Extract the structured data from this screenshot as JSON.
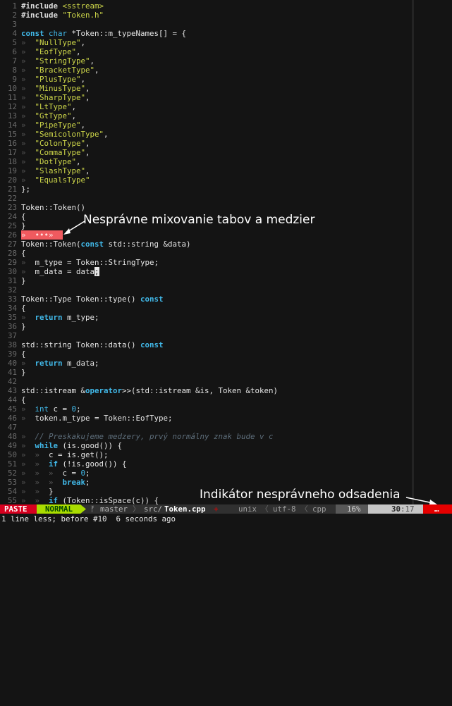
{
  "editor": {
    "lines": [
      {
        "n": "1",
        "segs": [
          {
            "t": "#include ",
            "c": "inc"
          },
          {
            "t": "<sstream>",
            "c": "str"
          }
        ]
      },
      {
        "n": "2",
        "segs": [
          {
            "t": "#include ",
            "c": "inc"
          },
          {
            "t": "\"Token.h\"",
            "c": "str"
          }
        ]
      },
      {
        "n": "3",
        "segs": []
      },
      {
        "n": "4",
        "segs": [
          {
            "t": "const",
            "c": "kw"
          },
          {
            "t": " "
          },
          {
            "t": "char",
            "c": "ty"
          },
          {
            "t": " *Token::m_typeNames[] = {"
          }
        ]
      },
      {
        "n": "5",
        "segs": [
          {
            "t": "»  ",
            "c": "tab"
          },
          {
            "t": "\"NullType\"",
            "c": "str"
          },
          {
            "t": ","
          }
        ]
      },
      {
        "n": "6",
        "segs": [
          {
            "t": "»  ",
            "c": "tab"
          },
          {
            "t": "\"EofType\"",
            "c": "str"
          },
          {
            "t": ","
          }
        ]
      },
      {
        "n": "7",
        "segs": [
          {
            "t": "»  ",
            "c": "tab"
          },
          {
            "t": "\"StringType\"",
            "c": "str"
          },
          {
            "t": ","
          }
        ]
      },
      {
        "n": "8",
        "segs": [
          {
            "t": "»  ",
            "c": "tab"
          },
          {
            "t": "\"BracketType\"",
            "c": "str"
          },
          {
            "t": ","
          }
        ]
      },
      {
        "n": "9",
        "segs": [
          {
            "t": "»  ",
            "c": "tab"
          },
          {
            "t": "\"PlusType\"",
            "c": "str"
          },
          {
            "t": ","
          }
        ]
      },
      {
        "n": "10",
        "segs": [
          {
            "t": "»  ",
            "c": "tab"
          },
          {
            "t": "\"MinusType\"",
            "c": "str"
          },
          {
            "t": ","
          }
        ]
      },
      {
        "n": "11",
        "segs": [
          {
            "t": "»  ",
            "c": "tab"
          },
          {
            "t": "\"SharpType\"",
            "c": "str"
          },
          {
            "t": ","
          }
        ]
      },
      {
        "n": "12",
        "segs": [
          {
            "t": "»  ",
            "c": "tab"
          },
          {
            "t": "\"LtType\"",
            "c": "str"
          },
          {
            "t": ","
          }
        ]
      },
      {
        "n": "13",
        "segs": [
          {
            "t": "»  ",
            "c": "tab"
          },
          {
            "t": "\"GtType\"",
            "c": "str"
          },
          {
            "t": ","
          }
        ]
      },
      {
        "n": "14",
        "segs": [
          {
            "t": "»  ",
            "c": "tab"
          },
          {
            "t": "\"PipeType\"",
            "c": "str"
          },
          {
            "t": ","
          }
        ]
      },
      {
        "n": "15",
        "segs": [
          {
            "t": "»  ",
            "c": "tab"
          },
          {
            "t": "\"SemicolonType\"",
            "c": "str"
          },
          {
            "t": ","
          }
        ]
      },
      {
        "n": "16",
        "segs": [
          {
            "t": "»  ",
            "c": "tab"
          },
          {
            "t": "\"ColonType\"",
            "c": "str"
          },
          {
            "t": ","
          }
        ]
      },
      {
        "n": "17",
        "segs": [
          {
            "t": "»  ",
            "c": "tab"
          },
          {
            "t": "\"CommaType\"",
            "c": "str"
          },
          {
            "t": ","
          }
        ]
      },
      {
        "n": "18",
        "segs": [
          {
            "t": "»  ",
            "c": "tab"
          },
          {
            "t": "\"DotType\"",
            "c": "str"
          },
          {
            "t": ","
          }
        ]
      },
      {
        "n": "19",
        "segs": [
          {
            "t": "»  ",
            "c": "tab"
          },
          {
            "t": "\"SlashType\"",
            "c": "str"
          },
          {
            "t": ","
          }
        ]
      },
      {
        "n": "20",
        "segs": [
          {
            "t": "»  ",
            "c": "tab"
          },
          {
            "t": "\"EqualsType\"",
            "c": "str"
          }
        ]
      },
      {
        "n": "21",
        "segs": [
          {
            "t": "};"
          }
        ]
      },
      {
        "n": "22",
        "segs": []
      },
      {
        "n": "23",
        "segs": [
          {
            "t": "Token::Token()"
          }
        ]
      },
      {
        "n": "24",
        "segs": [
          {
            "t": "{"
          }
        ]
      },
      {
        "n": "25",
        "segs": [
          {
            "t": "}"
          }
        ]
      },
      {
        "n": "26",
        "segs": [
          {
            "t": "»  •••»  ",
            "c": "bad"
          }
        ]
      },
      {
        "n": "27",
        "segs": [
          {
            "t": "Token::Token("
          },
          {
            "t": "const",
            "c": "kw"
          },
          {
            "t": " std::string &data)"
          }
        ]
      },
      {
        "n": "28",
        "segs": [
          {
            "t": "{"
          }
        ]
      },
      {
        "n": "29",
        "segs": [
          {
            "t": "»  ",
            "c": "tab"
          },
          {
            "t": "m_type = Token::StringType;"
          }
        ]
      },
      {
        "n": "30",
        "segs": [
          {
            "t": "»  ",
            "c": "tab"
          },
          {
            "t": "m_data = data"
          },
          {
            "t": ";",
            "c": "cursor"
          }
        ]
      },
      {
        "n": "31",
        "segs": [
          {
            "t": "}"
          }
        ]
      },
      {
        "n": "32",
        "segs": []
      },
      {
        "n": "33",
        "segs": [
          {
            "t": "Token::Type Token::type() "
          },
          {
            "t": "const",
            "c": "kw"
          }
        ]
      },
      {
        "n": "34",
        "segs": [
          {
            "t": "{"
          }
        ]
      },
      {
        "n": "35",
        "segs": [
          {
            "t": "»  ",
            "c": "tab"
          },
          {
            "t": "return",
            "c": "kw"
          },
          {
            "t": " m_type;"
          }
        ]
      },
      {
        "n": "36",
        "segs": [
          {
            "t": "}"
          }
        ]
      },
      {
        "n": "37",
        "segs": []
      },
      {
        "n": "38",
        "segs": [
          {
            "t": "std::string Token::data() "
          },
          {
            "t": "const",
            "c": "kw"
          }
        ]
      },
      {
        "n": "39",
        "segs": [
          {
            "t": "{"
          }
        ]
      },
      {
        "n": "40",
        "segs": [
          {
            "t": "»  ",
            "c": "tab"
          },
          {
            "t": "return",
            "c": "kw"
          },
          {
            "t": " m_data;"
          }
        ]
      },
      {
        "n": "41",
        "segs": [
          {
            "t": "}"
          }
        ]
      },
      {
        "n": "42",
        "segs": []
      },
      {
        "n": "43",
        "segs": [
          {
            "t": "std::istream &"
          },
          {
            "t": "operator",
            "c": "kw"
          },
          {
            "t": ">>(std::istream &is, Token &token)"
          }
        ]
      },
      {
        "n": "44",
        "segs": [
          {
            "t": "{"
          }
        ]
      },
      {
        "n": "45",
        "segs": [
          {
            "t": "»  ",
            "c": "tab"
          },
          {
            "t": "int",
            "c": "ty"
          },
          {
            "t": " c = "
          },
          {
            "t": "0",
            "c": "num"
          },
          {
            "t": ";"
          }
        ]
      },
      {
        "n": "46",
        "segs": [
          {
            "t": "»  ",
            "c": "tab"
          },
          {
            "t": "token.m_type = Token::EofType;"
          }
        ]
      },
      {
        "n": "47",
        "segs": []
      },
      {
        "n": "48",
        "segs": [
          {
            "t": "»  ",
            "c": "tab"
          },
          {
            "t": "// Preskakujeme medzery, prvý normálny znak bude v c",
            "c": "cm"
          }
        ]
      },
      {
        "n": "49",
        "segs": [
          {
            "t": "»  ",
            "c": "tab"
          },
          {
            "t": "while",
            "c": "kw"
          },
          {
            "t": " (is.good()) {"
          }
        ]
      },
      {
        "n": "50",
        "segs": [
          {
            "t": "»  »  ",
            "c": "tab"
          },
          {
            "t": "c = is.get();"
          }
        ]
      },
      {
        "n": "51",
        "segs": [
          {
            "t": "»  »  ",
            "c": "tab"
          },
          {
            "t": "if",
            "c": "kw"
          },
          {
            "t": " (!is.good()) {"
          }
        ]
      },
      {
        "n": "52",
        "segs": [
          {
            "t": "»  »  »  ",
            "c": "tab"
          },
          {
            "t": "c = "
          },
          {
            "t": "0",
            "c": "num"
          },
          {
            "t": ";"
          }
        ]
      },
      {
        "n": "53",
        "segs": [
          {
            "t": "»  »  »  ",
            "c": "tab"
          },
          {
            "t": "break",
            "c": "kw"
          },
          {
            "t": ";"
          }
        ]
      },
      {
        "n": "54",
        "segs": [
          {
            "t": "»  »  ",
            "c": "tab"
          },
          {
            "t": "}"
          }
        ]
      },
      {
        "n": "55",
        "segs": [
          {
            "t": "»  »  ",
            "c": "tab"
          },
          {
            "t": "if",
            "c": "kw"
          },
          {
            "t": " (Token::isSpace(c)) {"
          }
        ]
      }
    ]
  },
  "annotations": {
    "mixed_tabs": "Nesprávne mixovanie tabov a medzier",
    "indent_indicator": "Indikátor nesprávneho odsadenia"
  },
  "statusline": {
    "paste": "PASTE",
    "mode": "NORMAL",
    "branch_icon": "ᚠ",
    "branch": "master",
    "path_dir": "src/",
    "file": "Token.cpp",
    "modified_icon": "+",
    "format": "unix",
    "encoding": "utf-8",
    "filetype": "cpp",
    "percent": "16%",
    "position_line": "30",
    "position_col": ":17",
    "warning": "…"
  },
  "cmdline": "1 line less; before #10  6 seconds ago",
  "colors": {
    "background": "#141414",
    "paste_bg": "#d7001f",
    "normal_bg": "#aadd00",
    "warning_bg": "#e60000",
    "bad_whitespace": "#f05a5f"
  }
}
